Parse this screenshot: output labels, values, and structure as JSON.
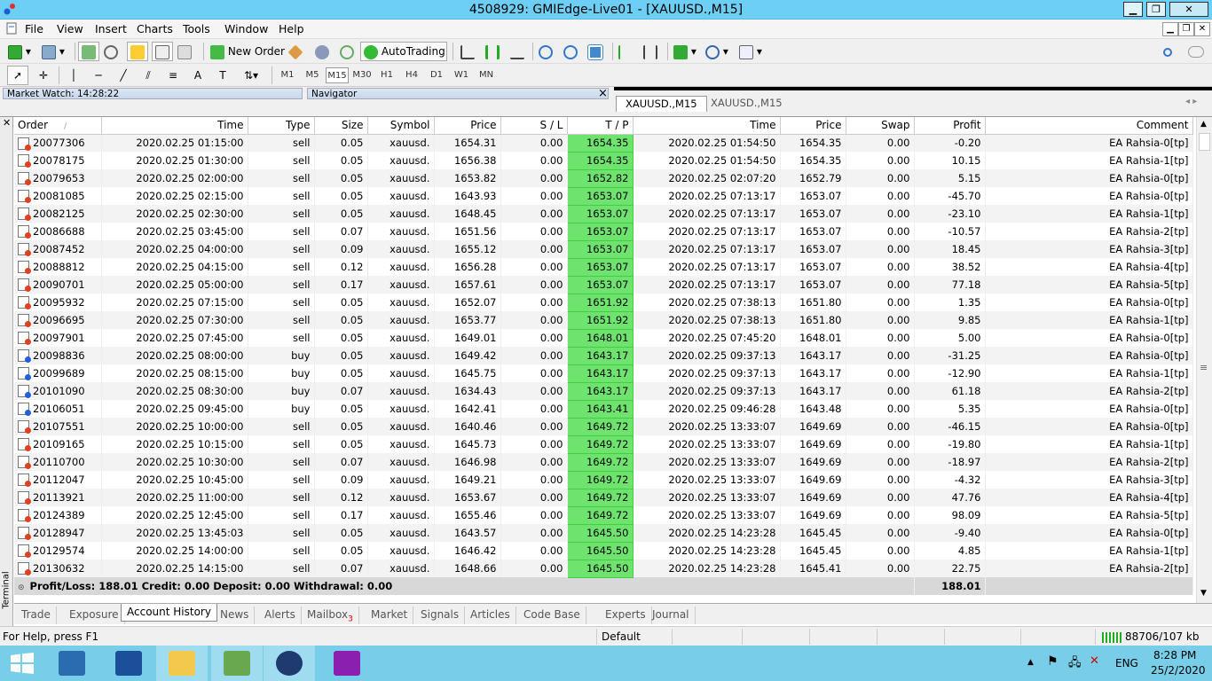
{
  "window": {
    "title": "4508929: GMIEdge-Live01 - [XAUUSD.,M15]",
    "minimize": "▁",
    "restore": "❐",
    "close": "✕"
  },
  "menu": [
    "File",
    "View",
    "Insert",
    "Charts",
    "Tools",
    "Window",
    "Help"
  ],
  "toolbar": {
    "new_order": "New Order",
    "autotrading": "AutoTrading"
  },
  "timeframes": [
    "M1",
    "M5",
    "M15",
    "M30",
    "H1",
    "H4",
    "D1",
    "W1",
    "MN"
  ],
  "active_timeframe": "M15",
  "panels": {
    "market_watch": "Market Watch: 14:28:22",
    "navigator": "Navigator",
    "close": "×"
  },
  "chart_tabs": [
    {
      "label": "XAUUSD.,M15",
      "active": true
    },
    {
      "label": "XAUUSD.,M15",
      "active": false
    }
  ],
  "terminal": {
    "side_label": "Terminal",
    "columns": [
      "Order",
      "Time",
      "Type",
      "Size",
      "Symbol",
      "Price",
      "S / L",
      "T / P",
      "Time",
      "Price",
      "Swap",
      "Profit",
      "Comment"
    ],
    "rows": [
      [
        "20077306",
        "2020.02.25 01:15:00",
        "sell",
        "0.05",
        "xauusd.",
        "1654.31",
        "0.00",
        "1654.35",
        "2020.02.25 01:54:50",
        "1654.35",
        "0.00",
        "-0.20",
        "EA Rahsia-0[tp]"
      ],
      [
        "20078175",
        "2020.02.25 01:30:00",
        "sell",
        "0.05",
        "xauusd.",
        "1656.38",
        "0.00",
        "1654.35",
        "2020.02.25 01:54:50",
        "1654.35",
        "0.00",
        "10.15",
        "EA Rahsia-1[tp]"
      ],
      [
        "20079653",
        "2020.02.25 02:00:00",
        "sell",
        "0.05",
        "xauusd.",
        "1653.82",
        "0.00",
        "1652.82",
        "2020.02.25 02:07:20",
        "1652.79",
        "0.00",
        "5.15",
        "EA Rahsia-0[tp]"
      ],
      [
        "20081085",
        "2020.02.25 02:15:00",
        "sell",
        "0.05",
        "xauusd.",
        "1643.93",
        "0.00",
        "1653.07",
        "2020.02.25 07:13:17",
        "1653.07",
        "0.00",
        "-45.70",
        "EA Rahsia-0[tp]"
      ],
      [
        "20082125",
        "2020.02.25 02:30:00",
        "sell",
        "0.05",
        "xauusd.",
        "1648.45",
        "0.00",
        "1653.07",
        "2020.02.25 07:13:17",
        "1653.07",
        "0.00",
        "-23.10",
        "EA Rahsia-1[tp]"
      ],
      [
        "20086688",
        "2020.02.25 03:45:00",
        "sell",
        "0.07",
        "xauusd.",
        "1651.56",
        "0.00",
        "1653.07",
        "2020.02.25 07:13:17",
        "1653.07",
        "0.00",
        "-10.57",
        "EA Rahsia-2[tp]"
      ],
      [
        "20087452",
        "2020.02.25 04:00:00",
        "sell",
        "0.09",
        "xauusd.",
        "1655.12",
        "0.00",
        "1653.07",
        "2020.02.25 07:13:17",
        "1653.07",
        "0.00",
        "18.45",
        "EA Rahsia-3[tp]"
      ],
      [
        "20088812",
        "2020.02.25 04:15:00",
        "sell",
        "0.12",
        "xauusd.",
        "1656.28",
        "0.00",
        "1653.07",
        "2020.02.25 07:13:17",
        "1653.07",
        "0.00",
        "38.52",
        "EA Rahsia-4[tp]"
      ],
      [
        "20090701",
        "2020.02.25 05:00:00",
        "sell",
        "0.17",
        "xauusd.",
        "1657.61",
        "0.00",
        "1653.07",
        "2020.02.25 07:13:17",
        "1653.07",
        "0.00",
        "77.18",
        "EA Rahsia-5[tp]"
      ],
      [
        "20095932",
        "2020.02.25 07:15:00",
        "sell",
        "0.05",
        "xauusd.",
        "1652.07",
        "0.00",
        "1651.92",
        "2020.02.25 07:38:13",
        "1651.80",
        "0.00",
        "1.35",
        "EA Rahsia-0[tp]"
      ],
      [
        "20096695",
        "2020.02.25 07:30:00",
        "sell",
        "0.05",
        "xauusd.",
        "1653.77",
        "0.00",
        "1651.92",
        "2020.02.25 07:38:13",
        "1651.80",
        "0.00",
        "9.85",
        "EA Rahsia-1[tp]"
      ],
      [
        "20097901",
        "2020.02.25 07:45:00",
        "sell",
        "0.05",
        "xauusd.",
        "1649.01",
        "0.00",
        "1648.01",
        "2020.02.25 07:45:20",
        "1648.01",
        "0.00",
        "5.00",
        "EA Rahsia-0[tp]"
      ],
      [
        "20098836",
        "2020.02.25 08:00:00",
        "buy",
        "0.05",
        "xauusd.",
        "1649.42",
        "0.00",
        "1643.17",
        "2020.02.25 09:37:13",
        "1643.17",
        "0.00",
        "-31.25",
        "EA Rahsia-0[tp]"
      ],
      [
        "20099689",
        "2020.02.25 08:15:00",
        "buy",
        "0.05",
        "xauusd.",
        "1645.75",
        "0.00",
        "1643.17",
        "2020.02.25 09:37:13",
        "1643.17",
        "0.00",
        "-12.90",
        "EA Rahsia-1[tp]"
      ],
      [
        "20101090",
        "2020.02.25 08:30:00",
        "buy",
        "0.07",
        "xauusd.",
        "1634.43",
        "0.00",
        "1643.17",
        "2020.02.25 09:37:13",
        "1643.17",
        "0.00",
        "61.18",
        "EA Rahsia-2[tp]"
      ],
      [
        "20106051",
        "2020.02.25 09:45:00",
        "buy",
        "0.05",
        "xauusd.",
        "1642.41",
        "0.00",
        "1643.41",
        "2020.02.25 09:46:28",
        "1643.48",
        "0.00",
        "5.35",
        "EA Rahsia-0[tp]"
      ],
      [
        "20107551",
        "2020.02.25 10:00:00",
        "sell",
        "0.05",
        "xauusd.",
        "1640.46",
        "0.00",
        "1649.72",
        "2020.02.25 13:33:07",
        "1649.69",
        "0.00",
        "-46.15",
        "EA Rahsia-0[tp]"
      ],
      [
        "20109165",
        "2020.02.25 10:15:00",
        "sell",
        "0.05",
        "xauusd.",
        "1645.73",
        "0.00",
        "1649.72",
        "2020.02.25 13:33:07",
        "1649.69",
        "0.00",
        "-19.80",
        "EA Rahsia-1[tp]"
      ],
      [
        "20110700",
        "2020.02.25 10:30:00",
        "sell",
        "0.07",
        "xauusd.",
        "1646.98",
        "0.00",
        "1649.72",
        "2020.02.25 13:33:07",
        "1649.69",
        "0.00",
        "-18.97",
        "EA Rahsia-2[tp]"
      ],
      [
        "20112047",
        "2020.02.25 10:45:00",
        "sell",
        "0.09",
        "xauusd.",
        "1649.21",
        "0.00",
        "1649.72",
        "2020.02.25 13:33:07",
        "1649.69",
        "0.00",
        "-4.32",
        "EA Rahsia-3[tp]"
      ],
      [
        "20113921",
        "2020.02.25 11:00:00",
        "sell",
        "0.12",
        "xauusd.",
        "1653.67",
        "0.00",
        "1649.72",
        "2020.02.25 13:33:07",
        "1649.69",
        "0.00",
        "47.76",
        "EA Rahsia-4[tp]"
      ],
      [
        "20124389",
        "2020.02.25 12:45:00",
        "sell",
        "0.17",
        "xauusd.",
        "1655.46",
        "0.00",
        "1649.72",
        "2020.02.25 13:33:07",
        "1649.69",
        "0.00",
        "98.09",
        "EA Rahsia-5[tp]"
      ],
      [
        "20128947",
        "2020.02.25 13:45:03",
        "sell",
        "0.05",
        "xauusd.",
        "1643.57",
        "0.00",
        "1645.50",
        "2020.02.25 14:23:28",
        "1645.45",
        "0.00",
        "-9.40",
        "EA Rahsia-0[tp]"
      ],
      [
        "20129574",
        "2020.02.25 14:00:00",
        "sell",
        "0.05",
        "xauusd.",
        "1646.42",
        "0.00",
        "1645.50",
        "2020.02.25 14:23:28",
        "1645.45",
        "0.00",
        "4.85",
        "EA Rahsia-1[tp]"
      ],
      [
        "20130632",
        "2020.02.25 14:15:00",
        "sell",
        "0.07",
        "xauusd.",
        "1648.66",
        "0.00",
        "1645.50",
        "2020.02.25 14:23:28",
        "1645.41",
        "0.00",
        "22.75",
        "EA Rahsia-2[tp]"
      ]
    ],
    "summary": {
      "text": "Profit/Loss: 188.01  Credit: 0.00  Deposit: 0.00  Withdrawal: 0.00",
      "total": "188.01"
    },
    "tabs": [
      "Trade",
      "Exposure",
      "Account History",
      "News",
      "Alerts",
      "Mailbox",
      "Market",
      "Signals",
      "Articles",
      "Code Base",
      "Experts",
      "Journal"
    ],
    "mailbox_badge": "3",
    "active_tab": "Account History"
  },
  "status": {
    "help": "For Help, press F1",
    "profile": "Default",
    "traffic": "88706/107 kb"
  },
  "taskbar": {
    "lang": "ENG",
    "time": "8:28 PM",
    "date": "25/2/2020"
  },
  "colors": {
    "titlebar": "#6ecff6",
    "tp_highlight": "#6ee46e",
    "taskbar": "#78cde8",
    "sell_dot": "#e04020",
    "buy_dot": "#2060e0"
  }
}
